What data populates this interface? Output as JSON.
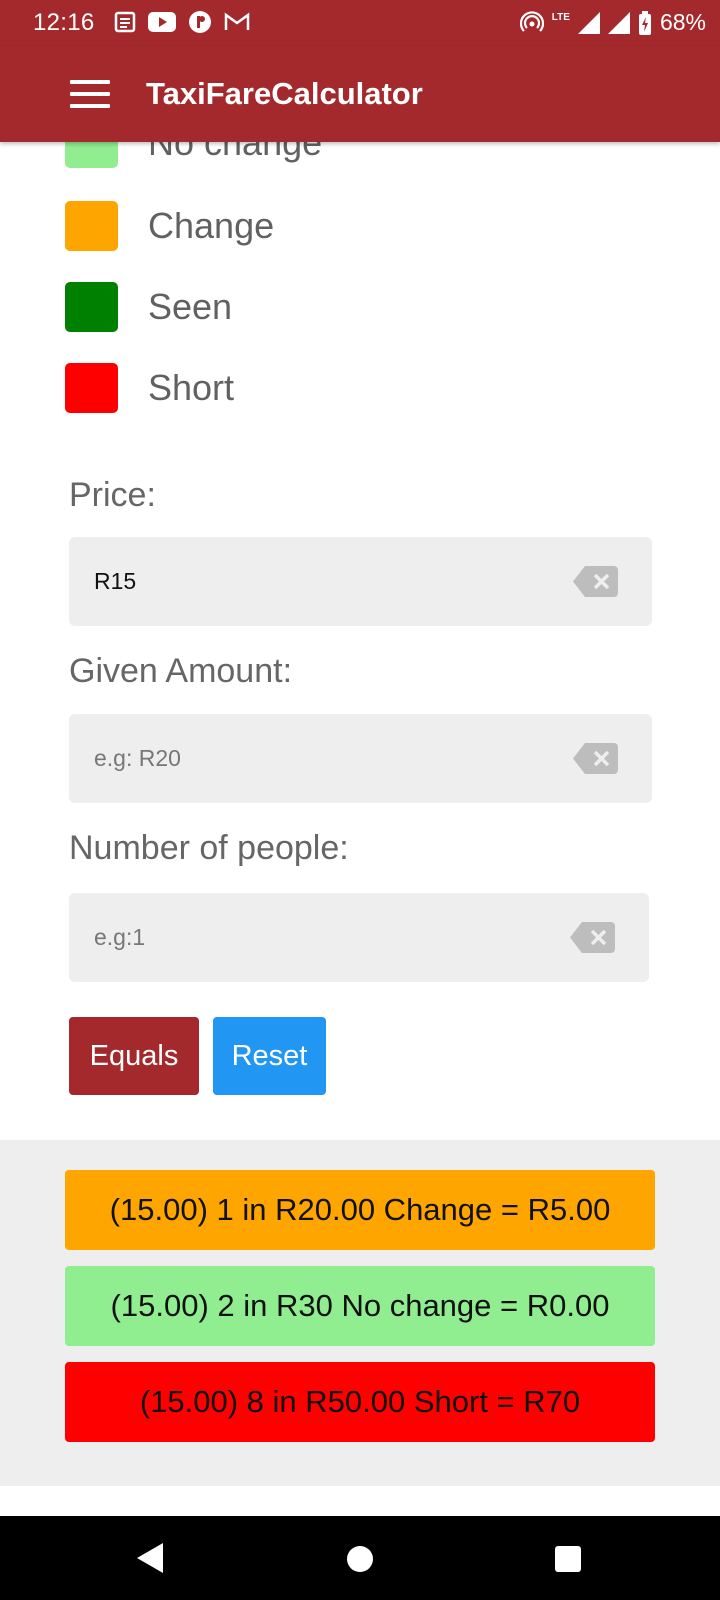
{
  "status_bar": {
    "time": "12:16",
    "battery": "68%",
    "network": "LTE"
  },
  "app_bar": {
    "title": "TaxiFareCalculator",
    "color": "#a4292c"
  },
  "legend": [
    {
      "label": "No change",
      "color": "#90ee90"
    },
    {
      "label": "Change",
      "color": "#ffa500"
    },
    {
      "label": "Seen",
      "color": "#008000"
    },
    {
      "label": "Short",
      "color": "#ff0000"
    }
  ],
  "form": {
    "price": {
      "label": "Price:",
      "value": "R15",
      "placeholder": ""
    },
    "given_amount": {
      "label": "Given Amount:",
      "value": "",
      "placeholder": "e.g: R20"
    },
    "people": {
      "label": "Number of people:",
      "value": "",
      "placeholder": "e.g:1"
    }
  },
  "buttons": {
    "equals": "Equals",
    "reset": "Reset"
  },
  "results": [
    {
      "text": "(15.00) 1 in R20.00 Change = R5.00",
      "color": "#ffa500"
    },
    {
      "text": "(15.00) 2 in R30 No change = R0.00",
      "color": "#90ee90"
    },
    {
      "text": "(15.00) 8 in R50.00 Short = R70",
      "color": "#ff0000"
    }
  ]
}
